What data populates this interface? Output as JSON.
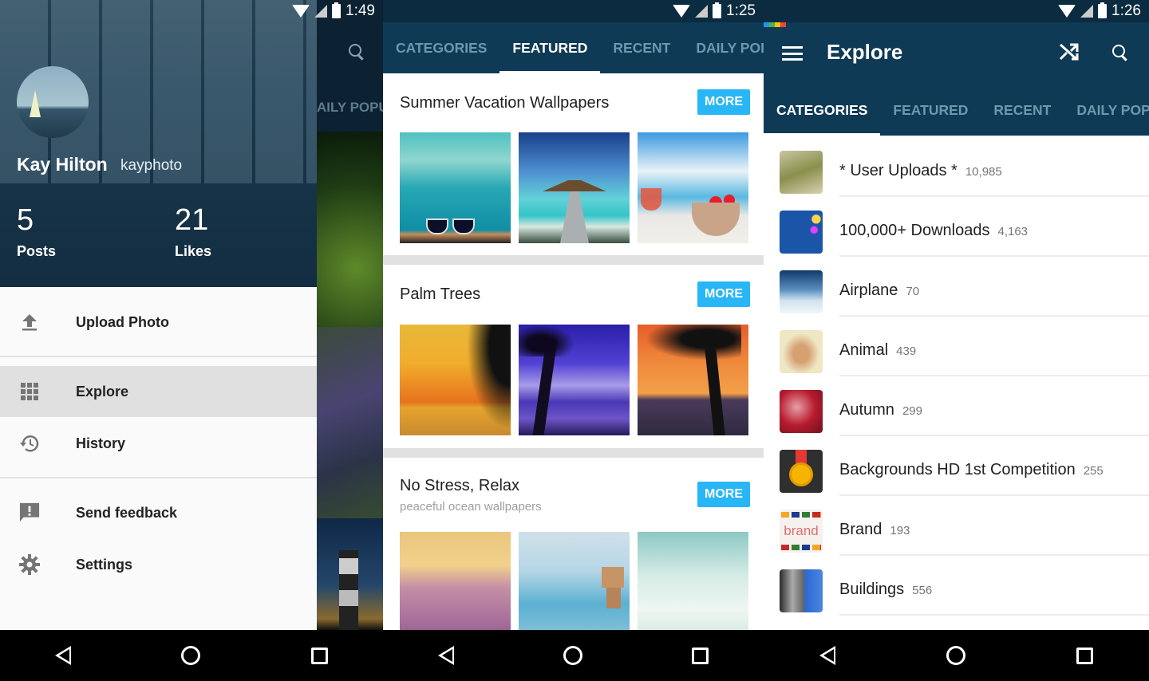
{
  "screen1": {
    "status": {
      "time": "1:49"
    },
    "profile": {
      "name": "Kay Hilton",
      "username": "kayphoto",
      "posts_count": "5",
      "posts_label": "Posts",
      "likes_count": "21",
      "likes_label": "Likes"
    },
    "drawer_items": [
      {
        "label": "Upload Photo",
        "icon": "upload-icon"
      },
      {
        "label": "Explore",
        "icon": "grid-icon",
        "active": true
      },
      {
        "label": "History",
        "icon": "history-icon"
      },
      {
        "label": "Send feedback",
        "icon": "feedback-icon"
      },
      {
        "label": "Settings",
        "icon": "gear-icon"
      }
    ],
    "behind_tab": "AILY POPU"
  },
  "screen2": {
    "status": {
      "time": "1:25"
    },
    "tabs": [
      "CATEGORIES",
      "FEATURED",
      "RECENT",
      "DAILY POPU"
    ],
    "active_tab": "FEATURED",
    "collections": [
      {
        "title": "Summer Vacation Wallpapers",
        "subtitle": "",
        "more_label": "MORE"
      },
      {
        "title": "Palm Trees",
        "subtitle": "",
        "more_label": "MORE"
      },
      {
        "title": "No Stress, Relax",
        "subtitle": "peaceful ocean wallpapers",
        "more_label": "MORE"
      }
    ],
    "accent": "#29b6f6"
  },
  "screen3": {
    "status": {
      "time": "1:26"
    },
    "title": "Explore",
    "tabs": [
      "CATEGORIES",
      "FEATURED",
      "RECENT",
      "DAILY POPU"
    ],
    "active_tab": "CATEGORIES",
    "categories": [
      {
        "name": "* User Uploads *",
        "count": "10,985"
      },
      {
        "name": "100,000+ Downloads",
        "count": "4,163"
      },
      {
        "name": "Airplane",
        "count": "70"
      },
      {
        "name": "Animal",
        "count": "439"
      },
      {
        "name": "Autumn",
        "count": "299"
      },
      {
        "name": "Backgrounds HD 1st Competition",
        "count": "255"
      },
      {
        "name": "Brand",
        "count": "193"
      },
      {
        "name": "Buildings",
        "count": "556"
      }
    ],
    "brand_thumb_text": "brand"
  },
  "colors": {
    "appbar": "#0e3a55",
    "accent": "#29b6f6"
  }
}
